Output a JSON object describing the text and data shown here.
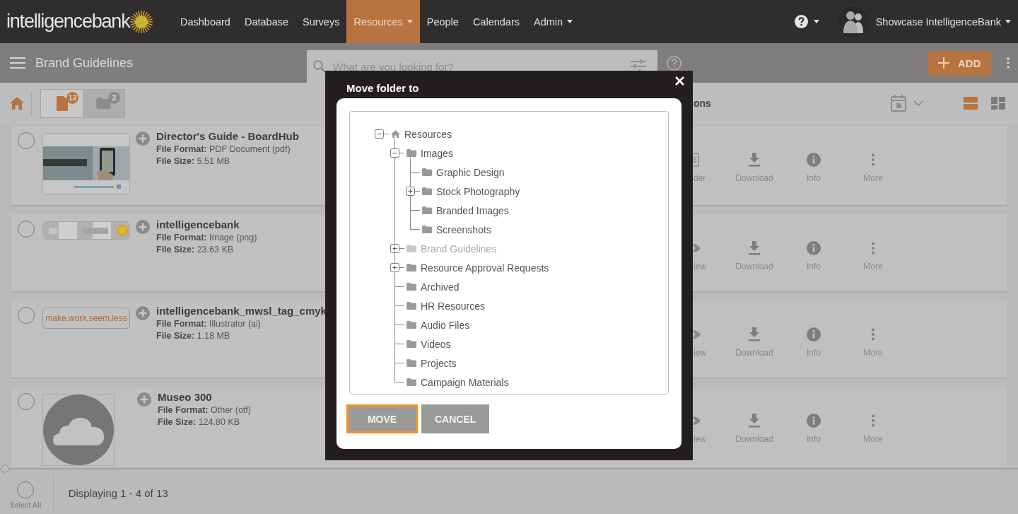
{
  "top_nav": {
    "logo": "intelligencebank",
    "items": [
      {
        "label": "Dashboard",
        "selected": false,
        "dropdown": false
      },
      {
        "label": "Database",
        "selected": false,
        "dropdown": false
      },
      {
        "label": "Surveys",
        "selected": false,
        "dropdown": false
      },
      {
        "label": "Resources",
        "selected": true,
        "dropdown": true
      },
      {
        "label": "People",
        "selected": false,
        "dropdown": false
      },
      {
        "label": "Calendars",
        "selected": false,
        "dropdown": false
      },
      {
        "label": "Admin",
        "selected": false,
        "dropdown": true
      }
    ],
    "account": "Showcase IntelligenceBank"
  },
  "sub_header": {
    "title": "Brand Guidelines",
    "search": {
      "placeholder": "What are you looking for?"
    },
    "add_button": "ADD"
  },
  "toolbar": {
    "tabs": [
      {
        "kind": "files",
        "badge": "13",
        "selected": true
      },
      {
        "kind": "folders",
        "badge": "2",
        "selected": false
      }
    ],
    "partial_label": "ons",
    "views": [
      {
        "kind": "list",
        "selected": true
      },
      {
        "kind": "grid",
        "selected": false
      }
    ]
  },
  "assets": [
    {
      "checked": false,
      "title": "Director's Guide - BoardHub",
      "format_label": "File Format:",
      "format": "PDF Document (pdf)",
      "size_label": "File Size:",
      "size": "5.51 MB",
      "actions": [
        {
          "kind": "reader",
          "label": "der"
        },
        {
          "kind": "download",
          "label": "Download"
        },
        {
          "kind": "info",
          "label": "Info"
        },
        {
          "kind": "more",
          "label": "More"
        }
      ]
    },
    {
      "checked": false,
      "title": "intelligencebank",
      "format_label": "File Format:",
      "format": "Image (png)",
      "size_label": "File Size:",
      "size": "23.63 KB",
      "thumbnail": {
        "kind": "logo"
      },
      "actions": [
        {
          "kind": "view",
          "label": "iew"
        },
        {
          "kind": "download",
          "label": "Download"
        },
        {
          "kind": "info",
          "label": "Info"
        },
        {
          "kind": "more",
          "label": "More"
        }
      ]
    },
    {
      "checked": false,
      "title": "intelligencebank_mwsl_tag_cmyk",
      "format_label": "File Format:",
      "format": "Illustrator (ai)",
      "size_label": "File Size:",
      "size": "1.18 MB",
      "thumbnail": {
        "kind": "text",
        "text": "make.work.seem.less"
      },
      "actions": [
        {
          "kind": "view",
          "label": "iew"
        },
        {
          "kind": "download",
          "label": "Download"
        },
        {
          "kind": "info",
          "label": "Info"
        },
        {
          "kind": "more",
          "label": "More"
        }
      ]
    },
    {
      "checked": false,
      "title": "Museo 300",
      "format_label": "File Format:",
      "format": "Other (otf)",
      "size_label": "File Size:",
      "size": "124.80 KB",
      "thumbnail": {
        "kind": "cloud"
      },
      "actions": [
        {
          "kind": "view",
          "label": "iew"
        },
        {
          "kind": "download",
          "label": "Download"
        },
        {
          "kind": "info",
          "label": "Info"
        },
        {
          "kind": "more",
          "label": "More"
        }
      ]
    }
  ],
  "footer": {
    "select_all": {
      "label": "Select All",
      "checked": false
    },
    "status": "Displaying 1 - 4 of 13"
  },
  "modal": {
    "title": "Move folder to",
    "tree": [
      {
        "label": "Resources",
        "kind": "home",
        "expanded": true,
        "disabled": false,
        "children": [
          {
            "label": "Images",
            "kind": "folder",
            "expanded": true,
            "disabled": false,
            "children": [
              {
                "label": "Graphic Design",
                "kind": "folder",
                "disabled": false
              },
              {
                "label": "Stock Photography",
                "kind": "folder",
                "expanded": false,
                "disabled": false
              },
              {
                "label": "Branded Images",
                "kind": "folder",
                "disabled": false
              },
              {
                "label": "Screenshots",
                "kind": "folder",
                "disabled": false
              }
            ]
          },
          {
            "label": "Brand Guidelines",
            "kind": "folder",
            "expanded": false,
            "disabled": true
          },
          {
            "label": "Resource Approval Requests",
            "kind": "folder",
            "expanded": false,
            "disabled": false
          },
          {
            "label": "Archived",
            "kind": "folder",
            "disabled": false
          },
          {
            "label": "HR Resources",
            "kind": "folder",
            "disabled": false
          },
          {
            "label": "Audio Files",
            "kind": "folder",
            "disabled": false
          },
          {
            "label": "Videos",
            "kind": "folder",
            "disabled": false
          },
          {
            "label": "Projects",
            "kind": "folder",
            "disabled": false
          },
          {
            "label": "Campaign Materials",
            "kind": "folder",
            "disabled": false
          }
        ]
      }
    ],
    "buttons": [
      {
        "label": "MOVE",
        "focused": true
      },
      {
        "label": "CANCEL",
        "focused": false
      }
    ]
  }
}
